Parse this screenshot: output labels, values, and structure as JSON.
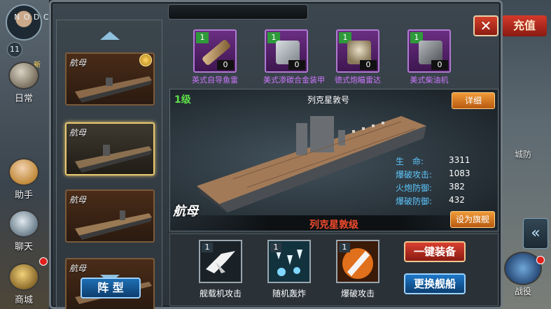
{
  "hud": {
    "avatar_label": "N O  D C",
    "player_level": "11",
    "new_tag": "新",
    "daily_label": "日常",
    "assistant_label": "助手",
    "chat_label": "聊天",
    "shop_label": "商城",
    "recharge_label": "充值",
    "defense_label": "城防",
    "battle_label": "战役",
    "collapse_symbol": "«"
  },
  "window": {
    "close_symbol": "✕"
  },
  "ship_list": {
    "items": [
      {
        "type": "航母"
      },
      {
        "type": "航母"
      },
      {
        "type": "航母"
      },
      {
        "type": "航母"
      }
    ],
    "formation_label": "阵 型"
  },
  "equipment": [
    {
      "level": "1",
      "count": "0",
      "name": "英式自导鱼雷",
      "icon": "torpedo-icon"
    },
    {
      "level": "1",
      "count": "0",
      "name": "美式渗碳合金装甲",
      "icon": "armor-plate-icon"
    },
    {
      "level": "1",
      "count": "0",
      "name": "德式炮瞄雷达",
      "icon": "radar-icon"
    },
    {
      "level": "1",
      "count": "0",
      "name": "美式柴油机",
      "icon": "engine-icon"
    }
  ],
  "detail": {
    "level": "1级",
    "ship_name": "列克星敦号",
    "detail_button": "详细",
    "ship_type": "航母",
    "class_name": "列克星敦级",
    "flagship_button": "设为旗舰",
    "stats": [
      {
        "label": "生　命:",
        "value": "3311"
      },
      {
        "label": "爆破攻击:",
        "value": "1083"
      },
      {
        "label": "火炮防御:",
        "value": "382"
      },
      {
        "label": "爆破防御:",
        "value": "432"
      }
    ]
  },
  "skills": [
    {
      "level": "1",
      "name": "舰载机攻击",
      "icon": "aircraft-attack-icon"
    },
    {
      "level": "1",
      "name": "随机轰炸",
      "icon": "random-bombing-icon"
    },
    {
      "level": "1",
      "name": "爆破攻击",
      "icon": "missile-attack-icon"
    }
  ],
  "actions": {
    "equip_all": "一键装备",
    "swap_ship": "更换舰船"
  }
}
